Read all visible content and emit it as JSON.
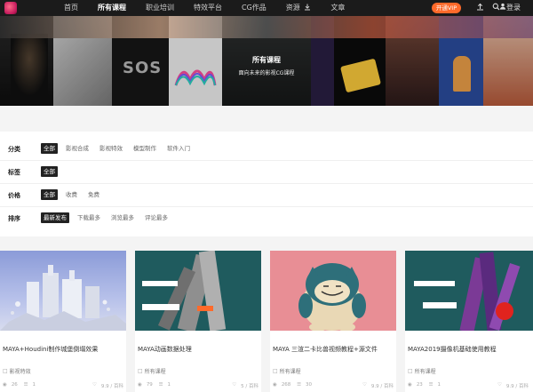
{
  "nav": {
    "items": [
      {
        "label": "首页",
        "active": false
      },
      {
        "label": "所有课程",
        "active": true
      },
      {
        "label": "职业培训",
        "active": false
      },
      {
        "label": "特效平台",
        "active": false
      },
      {
        "label": "CG作品",
        "active": false
      },
      {
        "label": "资源",
        "active": false
      },
      {
        "label": "文章",
        "active": false
      }
    ],
    "vip_label": "开通VIP",
    "login_label": "登录"
  },
  "icons": {
    "logo": "brand-logo-icon",
    "download": "download-icon",
    "upload": "upload-icon",
    "search": "search-icon",
    "user": "user-icon",
    "category": "folder-icon",
    "views": "eye-icon",
    "comments": "comment-icon",
    "likes": "like-icon"
  },
  "colors": {
    "topbar": "#1b1b1b",
    "vip": "#ff6a2a",
    "active_filter": "#222222"
  },
  "banner": {
    "title": "所有课程",
    "subtitle": "面向未来的影视CG课程"
  },
  "filters": [
    {
      "label": "分类",
      "options": [
        "全部",
        "影视合成",
        "影视特效",
        "模型制作",
        "软件入门"
      ],
      "active": 0
    },
    {
      "label": "标签",
      "options": [
        "全部"
      ],
      "active": 0
    },
    {
      "label": "价格",
      "options": [
        "全部",
        "收费",
        "免费"
      ],
      "active": 0
    },
    {
      "label": "排序",
      "options": [
        "最新发布",
        "下载最多",
        "浏览最多",
        "评论最多"
      ],
      "active": 0
    }
  ],
  "cards": [
    {
      "title": "MAYA+Houdini制作城堡倒塌效果",
      "category": "影视特效",
      "views": "26",
      "comments": "1",
      "likes": "9.9 / 百科"
    },
    {
      "title": "MAYA动画数据处理",
      "category": "所有课程",
      "views": "79",
      "comments": "1",
      "likes": "5 / 百科"
    },
    {
      "title": "MAYA 三渲二卡比兽视频教程+源文件",
      "category": "所有课程",
      "views": "268",
      "comments": "30",
      "likes": "9.9 / 百科"
    },
    {
      "title": "MAYA2019摄像机基础使用教程",
      "category": "所有课程",
      "views": "23",
      "comments": "1",
      "likes": "9.9 / 百科"
    }
  ]
}
